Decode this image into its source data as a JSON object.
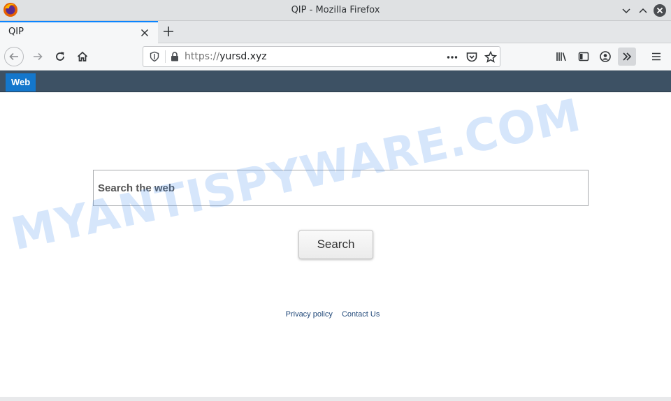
{
  "window": {
    "title": "QIP - Mozilla Firefox"
  },
  "tabs": [
    {
      "title": "QIP"
    }
  ],
  "urlbar": {
    "scheme": "https://",
    "host": "yursd.xyz"
  },
  "page": {
    "nav_tab_label": "Web",
    "search_placeholder": "Search the web",
    "search_button_label": "Search",
    "footer": {
      "privacy_label": "Privacy policy",
      "contact_label": "Contact Us"
    },
    "watermark": "MYANTISPYWARE.COM"
  },
  "colors": {
    "accent_tab": "#0a84ff",
    "nav_strip": "#3d5164",
    "web_tab": "#1477cc",
    "link": "#234a7a"
  }
}
